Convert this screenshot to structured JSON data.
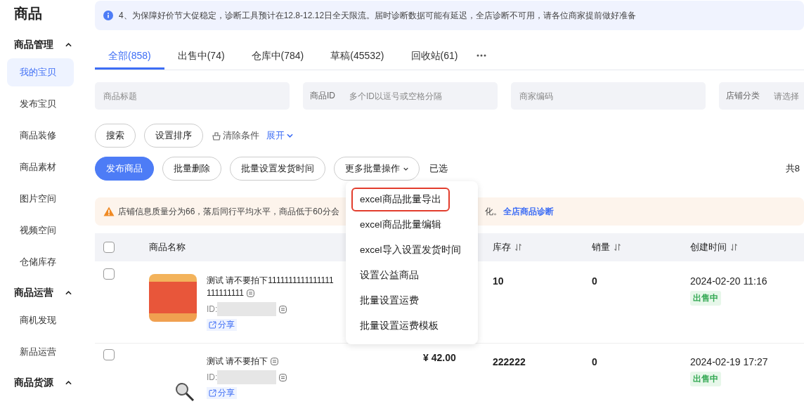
{
  "sidebar": {
    "title": "商品",
    "groups": [
      {
        "label": "商品管理",
        "expanded": true,
        "items": [
          {
            "label": "我的宝贝",
            "selected": true
          },
          {
            "label": "发布宝贝",
            "selected": false
          },
          {
            "label": "商品装修",
            "selected": false
          },
          {
            "label": "商品素材",
            "selected": false
          },
          {
            "label": "图片空间",
            "selected": false
          },
          {
            "label": "视频空间",
            "selected": false
          },
          {
            "label": "仓储库存",
            "selected": false
          }
        ]
      },
      {
        "label": "商品运营",
        "expanded": true,
        "items": [
          {
            "label": "商机发现",
            "selected": false
          },
          {
            "label": "新品运营",
            "selected": false
          }
        ]
      },
      {
        "label": "商品货源",
        "expanded": true
      }
    ]
  },
  "notice": {
    "text": "4、为保障好价节大促稳定，诊断工具预计在12.8-12.12日全天限流。届时诊断数据可能有延迟，全店诊断不可用，请各位商家提前做好准备"
  },
  "tabs": [
    {
      "label": "全部(858)",
      "selected": true
    },
    {
      "label": "出售中(74)",
      "selected": false
    },
    {
      "label": "仓库中(784)",
      "selected": false
    },
    {
      "label": "草稿(45532)",
      "selected": false
    },
    {
      "label": "回收站(61)",
      "selected": false
    }
  ],
  "filters": [
    {
      "placeholder": "商品标题"
    },
    {
      "label": "商品ID",
      "placeholder": "多个ID以逗号或空格分隔"
    },
    {
      "placeholder": "商家编码"
    },
    {
      "label": "店铺分类",
      "placeholder": "请选择"
    }
  ],
  "filter_actions": {
    "buttons": [
      "搜索",
      "设置排序"
    ],
    "clear": "清除条件",
    "expand": "展开"
  },
  "batch_actions": [
    {
      "label": "发布商品",
      "kind": "primary"
    },
    {
      "label": "批量删除",
      "kind": "default"
    },
    {
      "label": "批量设置发货时间",
      "kind": "default"
    },
    {
      "label": "更多批量操作",
      "kind": "dropdown"
    }
  ],
  "selected_label": "已选",
  "total": "共8",
  "warning": {
    "text": "店铺信息质量分为66，落后同行平均水平，商品低于60分会",
    "text_after": "化。",
    "link": "全店商品诊断"
  },
  "dropdown_menu": [
    {
      "label": "excel商品批量导出",
      "highlighted": true
    },
    {
      "label": "excel商品批量编辑",
      "highlighted": false
    },
    {
      "label": "excel导入设置发货时间",
      "highlighted": false
    },
    {
      "label": "设置公益商品",
      "highlighted": false
    },
    {
      "label": "批量设置运费",
      "highlighted": false
    },
    {
      "label": "批量设置运费模板",
      "highlighted": false
    }
  ],
  "table": {
    "header_checked": false,
    "name_column": "商品名称",
    "columns": [
      {
        "label": "库存",
        "sortable": true
      },
      {
        "label": "销量",
        "sortable": true
      },
      {
        "label": "创建时间",
        "sortable": true
      }
    ],
    "rows": [
      {
        "checked": false,
        "kind": "photo",
        "title": "测试 请不要拍下1111111111111111",
        "title_line2": "111111111",
        "id_label": "ID:",
        "share": "分享",
        "stock": "10",
        "sales": "0",
        "created": "2024-02-20 11:16",
        "status": "出售中"
      },
      {
        "checked": false,
        "kind": "icon",
        "title": "测试 请不要拍下",
        "id_label": "ID:",
        "share": "分享",
        "price": "¥ 42.00",
        "stock": "222222",
        "sales": "0",
        "created": "2024-02-19 17:27",
        "status": "出售中"
      }
    ]
  }
}
